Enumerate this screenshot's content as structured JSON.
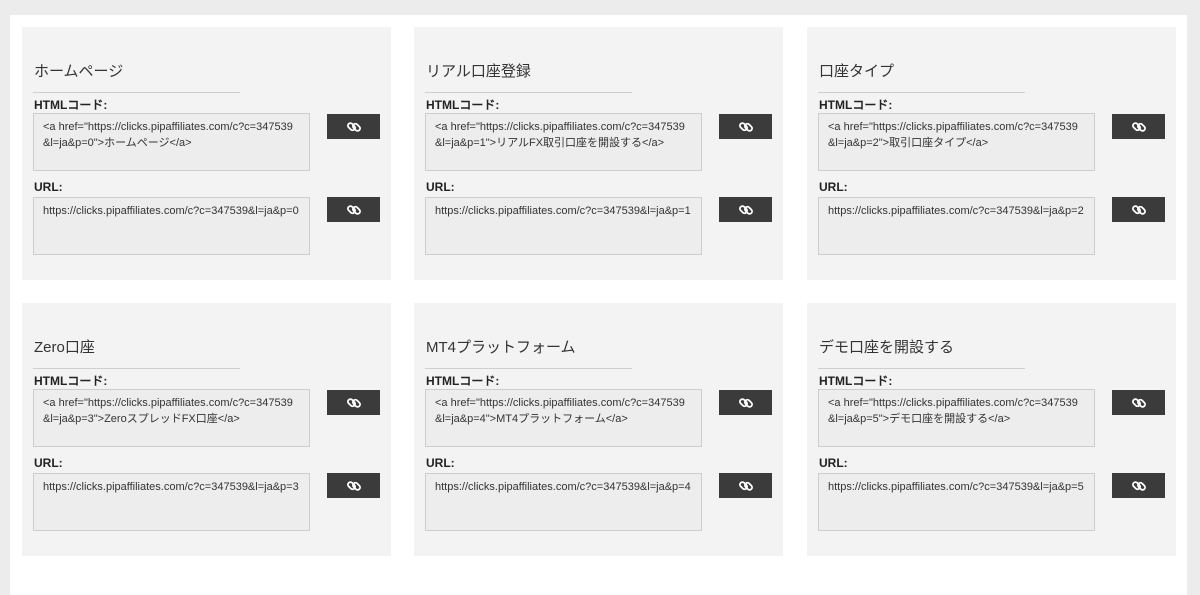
{
  "labels": {
    "html_code": "HTMLコード:",
    "url": "URL:"
  },
  "icon": "link-icon",
  "cards": [
    {
      "title": "ホームページ",
      "html": "<a href=\"https://clicks.pipaffiliates.com/c?c=347539&l=ja&p=0\">ホームページ</a>",
      "url": "https://clicks.pipaffiliates.com/c?c=347539&l=ja&p=0"
    },
    {
      "title": "リアル口座登録",
      "html": "<a href=\"https://clicks.pipaffiliates.com/c?c=347539&l=ja&p=1\">リアルFX取引口座を開設する</a>",
      "url": "https://clicks.pipaffiliates.com/c?c=347539&l=ja&p=1"
    },
    {
      "title": "口座タイプ",
      "html": "<a href=\"https://clicks.pipaffiliates.com/c?c=347539&l=ja&p=2\">取引口座タイプ</a>",
      "url": "https://clicks.pipaffiliates.com/c?c=347539&l=ja&p=2"
    },
    {
      "title": "Zero口座",
      "html": "<a href=\"https://clicks.pipaffiliates.com/c?c=347539&l=ja&p=3\">ZeroスプレッドFX口座</a>",
      "url": "https://clicks.pipaffiliates.com/c?c=347539&l=ja&p=3"
    },
    {
      "title": "MT4プラットフォーム",
      "html": "<a href=\"https://clicks.pipaffiliates.com/c?c=347539&l=ja&p=4\">MT4プラットフォーム</a>",
      "url": "https://clicks.pipaffiliates.com/c?c=347539&l=ja&p=4"
    },
    {
      "title": "デモ口座を開設する",
      "html": "<a href=\"https://clicks.pipaffiliates.com/c?c=347539&l=ja&p=5\">デモ口座を開設する</a>",
      "url": "https://clicks.pipaffiliates.com/c?c=347539&l=ja&p=5"
    }
  ]
}
